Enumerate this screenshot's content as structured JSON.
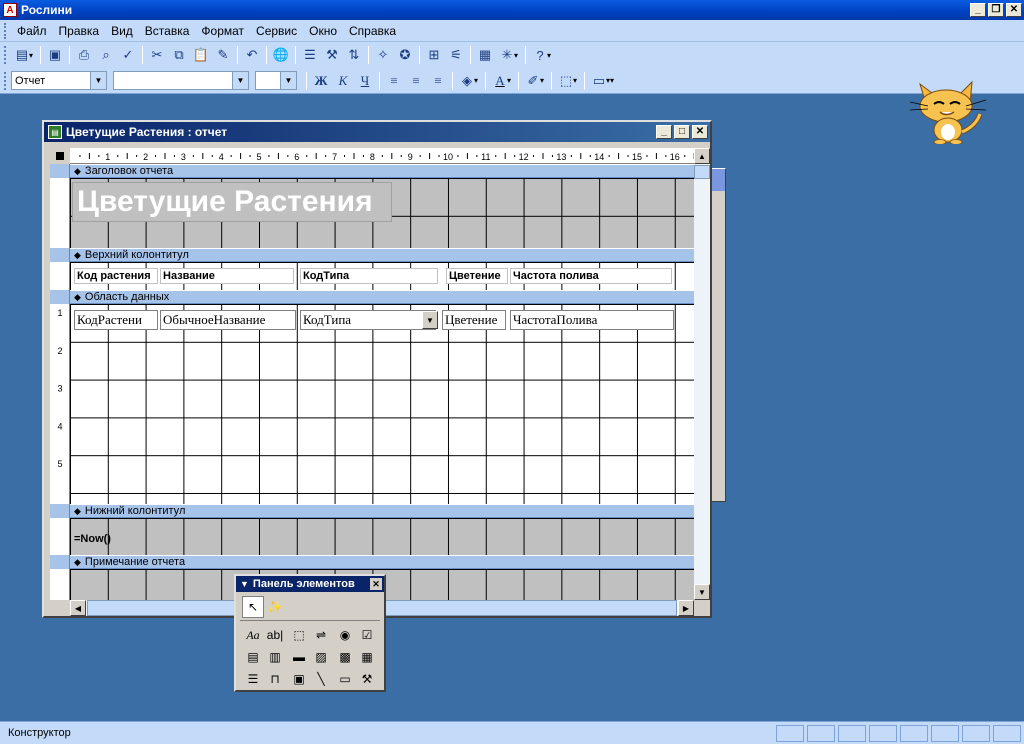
{
  "app": {
    "title": "Рослини"
  },
  "menu": [
    {
      "label": "Файл"
    },
    {
      "label": "Правка"
    },
    {
      "label": "Вид"
    },
    {
      "label": "Вставка"
    },
    {
      "label": "Формат"
    },
    {
      "label": "Сервис"
    },
    {
      "label": "Окно"
    },
    {
      "label": "Справка"
    }
  ],
  "format_toolbar": {
    "object_value": "Отчет",
    "font_value": "",
    "size_value": ""
  },
  "report_window": {
    "title": "Цветущие Растения : отчет"
  },
  "ruler_h": [
    "1",
    "2",
    "3",
    "4",
    "5",
    "6",
    "7",
    "8",
    "9",
    "10",
    "11",
    "12",
    "13",
    "14",
    "15",
    "16"
  ],
  "ruler_v": [
    "1",
    "2",
    "3",
    "4",
    "5"
  ],
  "sections": {
    "report_header": "Заголовок отчета",
    "page_header": "Верхний колонтитул",
    "detail": "Область данных",
    "page_footer": "Нижний колонтитул",
    "report_footer": "Примечание отчета"
  },
  "report_title": "Цветущие Растения",
  "header_labels": [
    "Код растения",
    "Название",
    "КодТипа",
    "Цветение",
    "Частота полива"
  ],
  "detail_fields": [
    "КодРастени",
    "ОбычноеНазвание",
    "КодТипа",
    "Цветение",
    "ЧастотаПолива"
  ],
  "footer_expr": "=Now()",
  "toolbox": {
    "title": "Панель элементов"
  },
  "status": {
    "text": "Конструктор"
  }
}
